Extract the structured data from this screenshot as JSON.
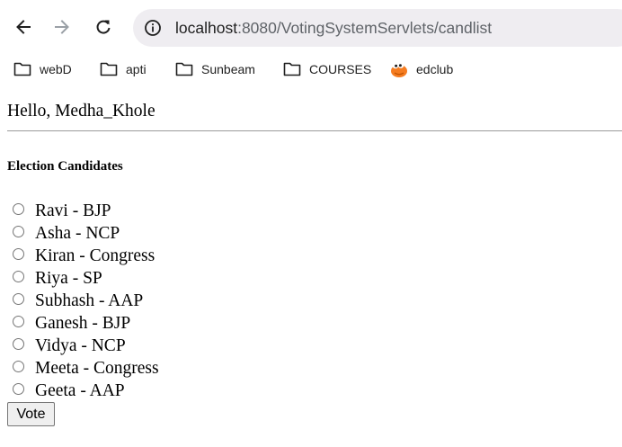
{
  "browser": {
    "url_host": "localhost",
    "url_rest": ":8080/VotingSystemServlets/candlist",
    "bookmarks": [
      {
        "label": "webD",
        "icon": "folder-icon"
      },
      {
        "label": "apti",
        "icon": "folder-icon"
      },
      {
        "label": "Sunbeam",
        "icon": "folder-icon"
      },
      {
        "label": "COURSES",
        "icon": "folder-icon"
      },
      {
        "label": "edclub",
        "icon": "edclub-icon"
      }
    ]
  },
  "page": {
    "greeting": "Hello, Medha_Khole",
    "heading": "Election Candidates",
    "candidates": [
      {
        "label": "Ravi - BJP"
      },
      {
        "label": "Asha - NCP"
      },
      {
        "label": "Kiran - Congress"
      },
      {
        "label": "Riya - SP"
      },
      {
        "label": "Subhash - AAP"
      },
      {
        "label": "Ganesh - BJP"
      },
      {
        "label": "Vidya - NCP"
      },
      {
        "label": "Meeta - Congress"
      },
      {
        "label": "Geeta - AAP"
      }
    ],
    "vote_label": "Vote"
  }
}
